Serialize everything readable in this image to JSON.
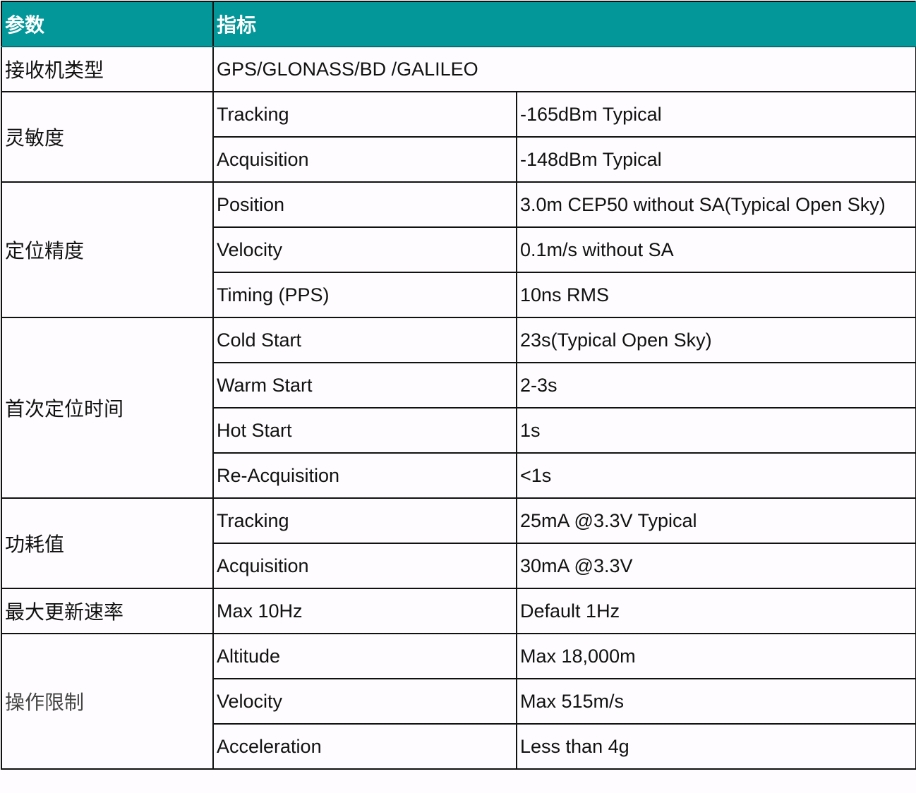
{
  "header": {
    "param": "参数",
    "spec": "指标"
  },
  "colors": {
    "header_bg": "#03979a",
    "header_text": "#ffffff"
  },
  "receiver_type": {
    "param": "接收机类型",
    "value": "GPS/GLONASS/BD /GALILEO"
  },
  "groups": [
    {
      "param": "灵敏度",
      "rows": [
        {
          "item": "Tracking",
          "value": "-165dBm Typical"
        },
        {
          "item": "Acquisition",
          "value": "-148dBm Typical"
        }
      ]
    },
    {
      "param": "定位精度",
      "rows": [
        {
          "item": "Position",
          "value": "3.0m CEP50 without SA(Typical Open Sky)"
        },
        {
          "item": "Velocity",
          "value": "0.1m/s without SA"
        },
        {
          "item": "Timing (PPS)",
          "value": "10ns RMS"
        }
      ]
    },
    {
      "param": "首次定位时间",
      "rows": [
        {
          "item": "Cold Start",
          "value": "23s(Typical Open Sky)"
        },
        {
          "item": "Warm Start",
          "value": "2-3s"
        },
        {
          "item": "Hot Start",
          "value": "1s"
        },
        {
          "item": "Re-Acquisition",
          "value": "<1s"
        }
      ]
    },
    {
      "param": "功耗值",
      "rows": [
        {
          "item": "Tracking",
          "value": "25mA @3.3V Typical"
        },
        {
          "item": "Acquisition",
          "value": "30mA @3.3V"
        }
      ]
    },
    {
      "param": "最大更新速率",
      "rows": [
        {
          "item": "Max 10Hz",
          "value": "Default 1Hz"
        }
      ]
    },
    {
      "param": "操作限制",
      "rows": [
        {
          "item": "Altitude",
          "value": "Max 18,000m"
        },
        {
          "item": "Velocity",
          "value": "Max 515m/s"
        },
        {
          "item": "Acceleration",
          "value": "Less than 4g"
        }
      ]
    }
  ]
}
